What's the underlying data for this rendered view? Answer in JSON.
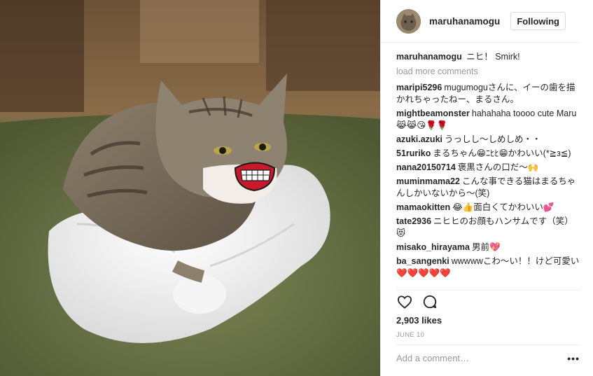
{
  "post": {
    "username": "maruhanamogu",
    "follow_label": "Following",
    "caption": {
      "username": "maruhanamogu",
      "text": "ニヒ！ Smirk!"
    },
    "load_more": "load more comments",
    "comments": [
      {
        "user": "maripi5296",
        "text": "mugumoguさんに、イーの歯を描かれちゃったねー、まるさん。"
      },
      {
        "user": "mightbeamonster",
        "text": "hahahaha toooo cute Maru😹😹😘🌹🌹"
      },
      {
        "user": "azuki.azuki",
        "text": "うっしし〜しめしめ・・"
      },
      {
        "user": "51ruriko",
        "text": "まるちゃん😁ﾆﾋﾋ😁かわいい(*≧з≦)"
      },
      {
        "user": "nana20150714",
        "text": "褒黒さんの口だ〜🙌"
      },
      {
        "user": "muminmama22",
        "text": "こんな事できる猫はまるちゃんしかいないから〜(笑)"
      },
      {
        "user": "mamaokitten",
        "text": "😂👍面白くてかわいい💕"
      },
      {
        "user": "tate2936",
        "text": "ニヒヒのお顔もハンサムです（笑）😻"
      },
      {
        "user": "misako_hirayama",
        "text": "男前💖"
      },
      {
        "user": "ba_sangenki",
        "text": "wwwwwこわ〜い！！けど可愛い❤️❤️❤️❤️❤️"
      }
    ],
    "likes": "2,903 likes",
    "date": "JUNE 10",
    "add_comment_placeholder": "Add a comment…",
    "more_options": "•••",
    "icons": {
      "like": "heart-icon",
      "comment": "speech-bubble-icon",
      "more": "more-options-icon"
    },
    "colors": {
      "border": "#efefef",
      "muted_text": "#999999",
      "text": "#262626"
    }
  }
}
